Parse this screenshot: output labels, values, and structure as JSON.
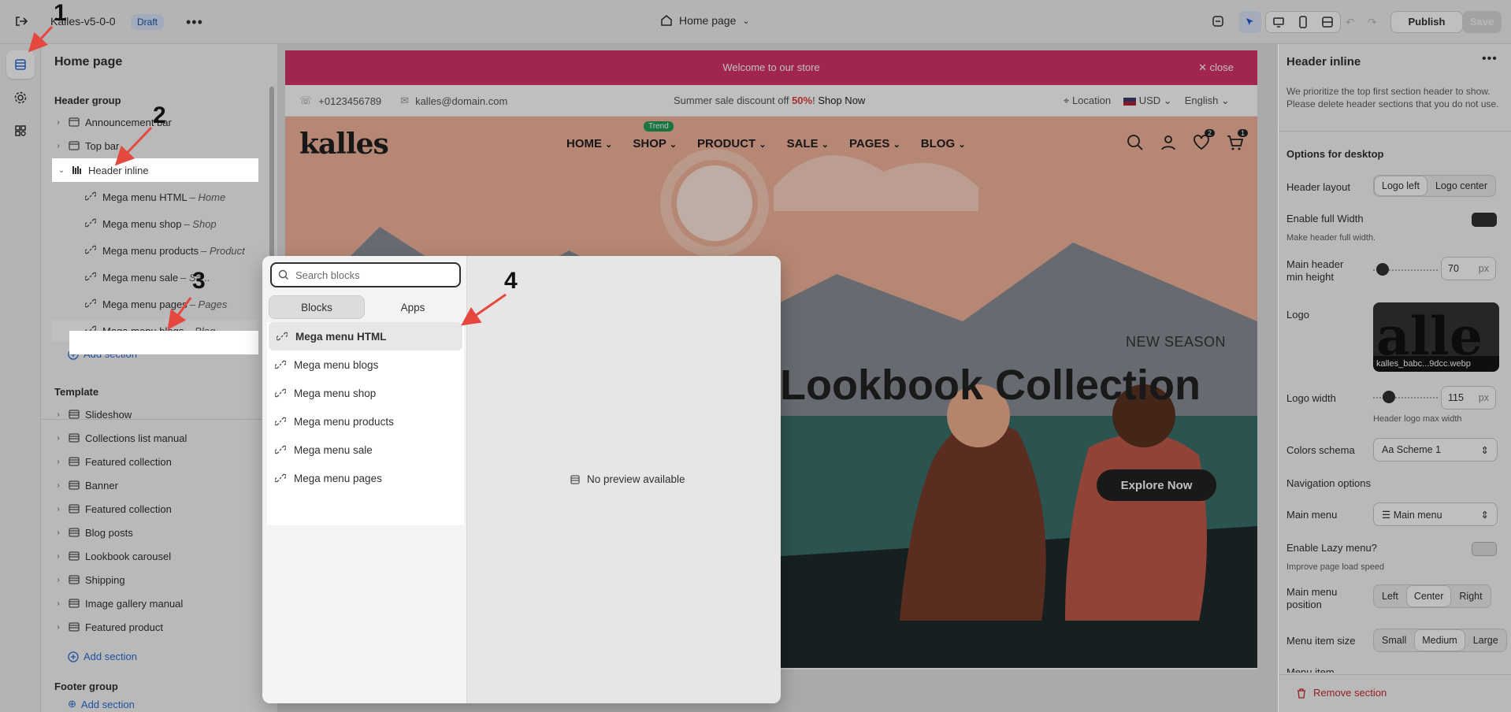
{
  "topbar": {
    "theme_name": "Kalles-v5-0-0",
    "status_badge": "Draft",
    "page_selector": "Home page",
    "publish_label": "Publish",
    "save_label": "Save"
  },
  "left_panel": {
    "title": "Home page",
    "header_group": {
      "title": "Header group",
      "items": [
        {
          "label": "Announcement bar"
        },
        {
          "label": "Top bar"
        },
        {
          "label": "Header inline"
        }
      ],
      "blocks": [
        {
          "label": "Mega menu HTML",
          "sub": "– Home"
        },
        {
          "label": "Mega menu shop",
          "sub": "– Shop"
        },
        {
          "label": "Mega menu products",
          "sub": "– Product"
        },
        {
          "label": "Mega menu sale",
          "sub": "– Sa..."
        },
        {
          "label": "Mega menu pages",
          "sub": "– Pages"
        },
        {
          "label": "Mega menu blogs",
          "sub": "– Blog"
        }
      ],
      "add_section": "Add section"
    },
    "template": {
      "title": "Template",
      "items": [
        {
          "label": "Slideshow"
        },
        {
          "label": "Collections list manual"
        },
        {
          "label": "Featured collection"
        },
        {
          "label": "Banner"
        },
        {
          "label": "Featured collection"
        },
        {
          "label": "Blog posts"
        },
        {
          "label": "Lookbook carousel"
        },
        {
          "label": "Shipping"
        },
        {
          "label": "Image gallery manual"
        },
        {
          "label": "Featured product"
        }
      ],
      "add_section": "Add section"
    },
    "footer_group": {
      "title": "Footer group",
      "add_section": "Add section"
    }
  },
  "preview": {
    "announcement": "Welcome to our store",
    "close": "close",
    "phone": "+0123456789",
    "email": "kalles@domain.com",
    "promo_prefix": "Summer sale discount off ",
    "promo_pct": "50%",
    "promo_suffix": "! ",
    "shop_now": "Shop Now",
    "location": "Location",
    "currency": "USD",
    "language": "English",
    "logo": "kalles",
    "nav": [
      "HOME",
      "SHOP",
      "PRODUCT",
      "SALE",
      "PAGES",
      "BLOG"
    ],
    "trend_badge": "Trend",
    "wishlist_count": "2",
    "cart_count": "1",
    "hero_kicker": "NEW SEASON",
    "hero_title": "Lookbook Collection",
    "hero_cta": "Explore Now"
  },
  "picker": {
    "search_placeholder": "Search blocks",
    "tabs": [
      "Blocks",
      "Apps"
    ],
    "items": [
      "Mega menu HTML",
      "Mega menu blogs",
      "Mega menu shop",
      "Mega menu products",
      "Mega menu sale",
      "Mega menu pages"
    ],
    "no_preview": "No preview available"
  },
  "right_panel": {
    "title": "Header inline",
    "intro": "We prioritize the top first section header to show. Please delete header sections that you do not use.",
    "options_title": "Options for desktop",
    "header_layout_label": "Header layout",
    "header_layout_options": [
      "Logo left",
      "Logo center"
    ],
    "full_width_label": "Enable full Width",
    "full_width_help": "Make header full width.",
    "min_height_label": "Main header min height",
    "min_height_value": "70",
    "px": "px",
    "logo_label": "Logo",
    "logo_filename": "kalles_babc...9dcc.webp",
    "logo_width_label": "Logo width",
    "logo_width_value": "115",
    "logo_width_help": "Header logo max width",
    "colors_label": "Colors schema",
    "colors_value": "Scheme 1",
    "nav_options": "Navigation options",
    "main_menu_label": "Main menu",
    "main_menu_value": "Main menu",
    "lazy_label": "Enable Lazy menu?",
    "lazy_help": "Improve page load speed",
    "menu_position_label": "Main menu position",
    "menu_position_options": [
      "Left",
      "Center",
      "Right"
    ],
    "menu_size_label": "Menu item size",
    "menu_size_options": [
      "Small",
      "Medium",
      "Large"
    ],
    "menu_item_partial": "Menu item",
    "remove_section": "Remove section"
  },
  "annotations": [
    "1",
    "2",
    "3",
    "4"
  ],
  "colors": {
    "accent": "#2b6cd6",
    "announcement": "#d6336c",
    "danger": "#c42b2b"
  }
}
